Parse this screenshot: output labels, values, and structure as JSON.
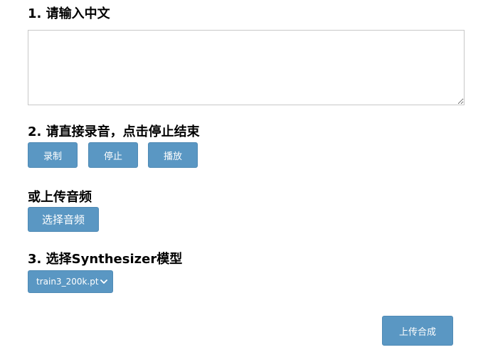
{
  "section1": {
    "title": "1. 请输入中文",
    "text_value": ""
  },
  "section2": {
    "title": "2. 请直接录音，点击停止结束",
    "record_label": "录制",
    "stop_label": "停止",
    "play_label": "播放"
  },
  "section_upload": {
    "title": "或上传音频",
    "choose_label": "选择音频"
  },
  "section3": {
    "title": "3. 选择Synthesizer模型",
    "model_selected": "train3_200k.pt"
  },
  "submit": {
    "label": "上传合成"
  },
  "colors": {
    "button_bg": "#5a97c3",
    "button_text": "#ffffff",
    "textarea_border": "#c8c8c8"
  },
  "icons": {
    "select_arrow": "chevron-down-icon"
  }
}
